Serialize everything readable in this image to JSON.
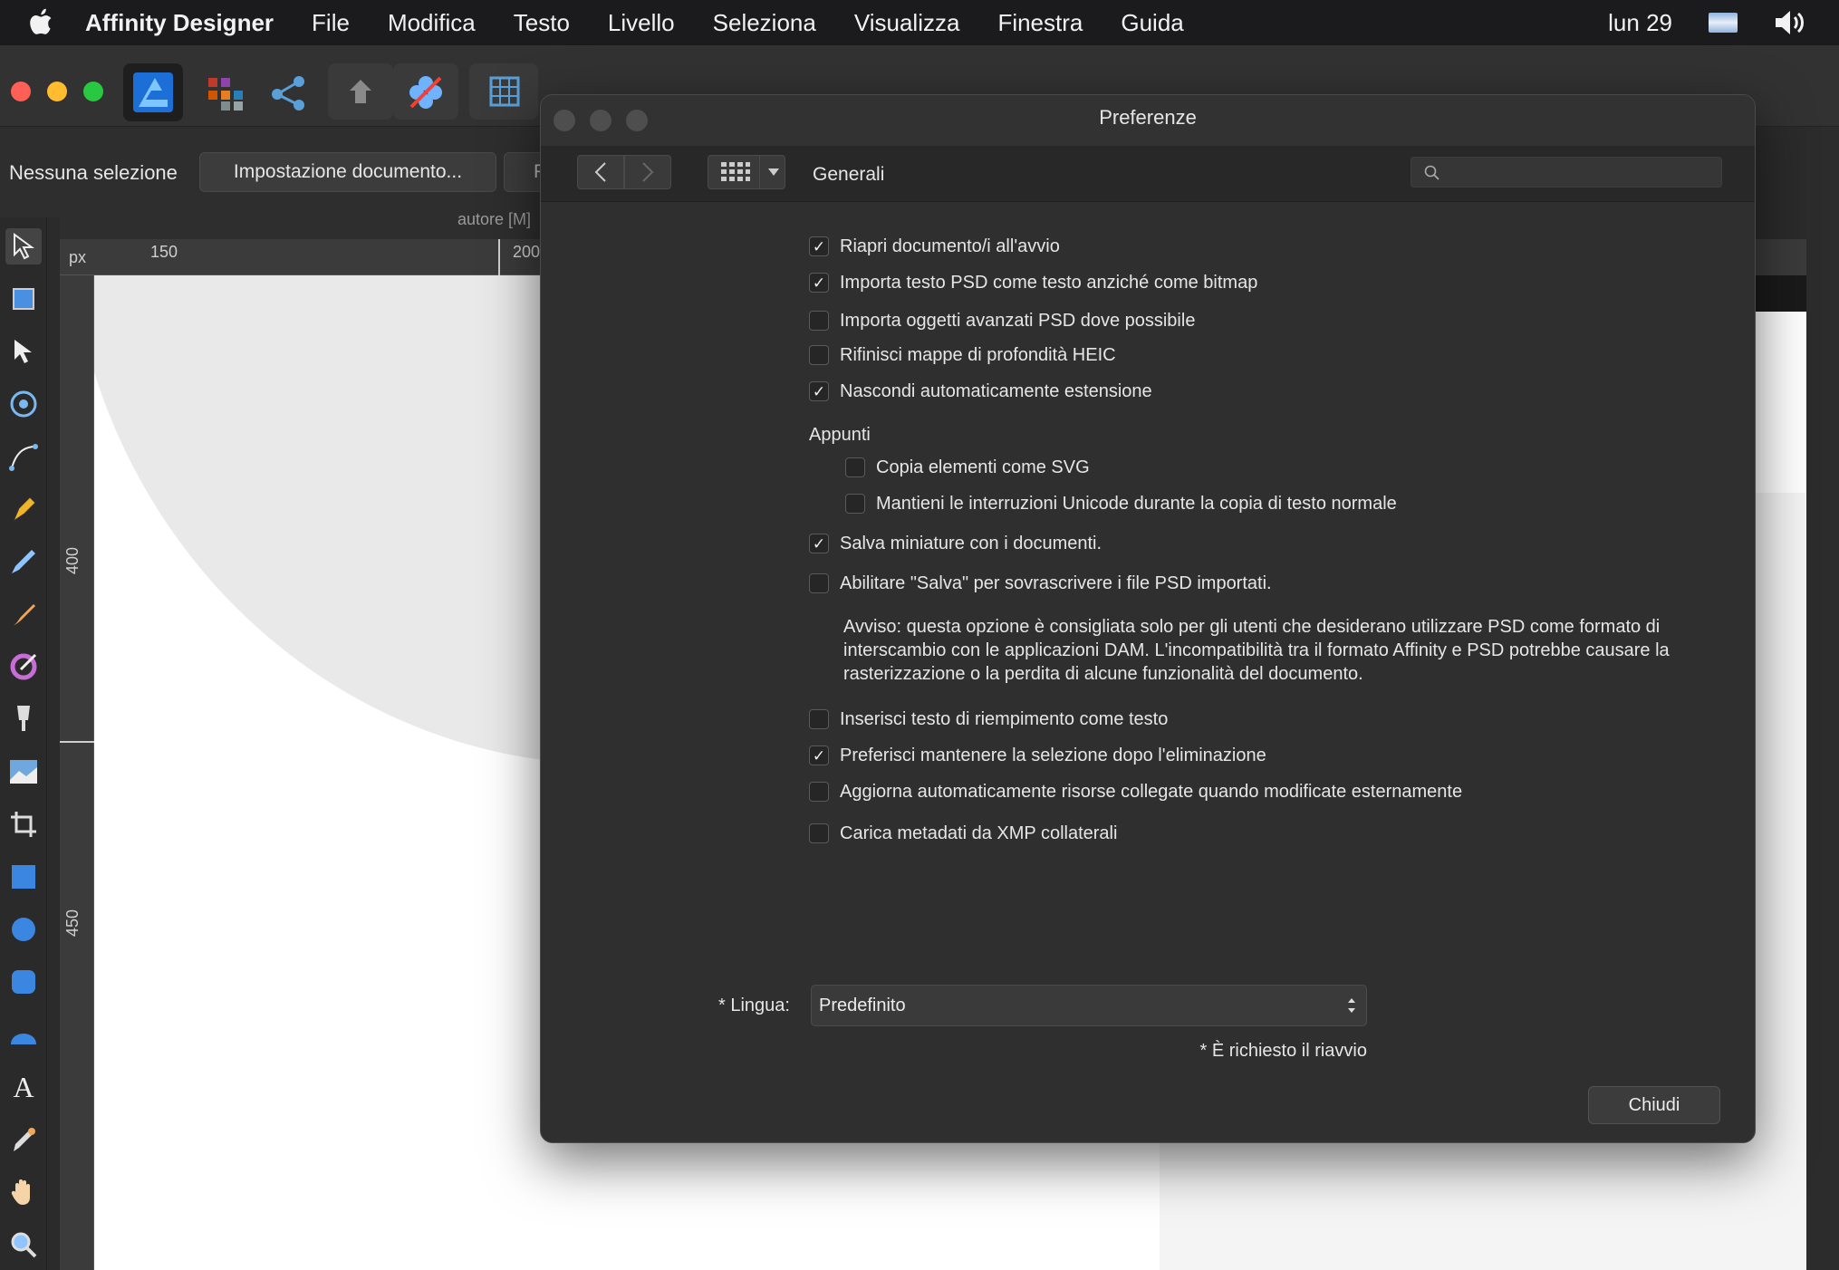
{
  "menubar": {
    "app_name": "Affinity Designer",
    "items": [
      "File",
      "Modifica",
      "Testo",
      "Livello",
      "Seleziona",
      "Visualizza",
      "Finestra",
      "Guida"
    ],
    "clock": "lun 29"
  },
  "context_bar": {
    "selection_status": "Nessuna selezione",
    "document_setup_button": "Impostazione documento...",
    "next_button_partial": "P"
  },
  "document": {
    "tab_title": "autore [M]",
    "ruler_unit": "px",
    "ruler_h_labels": [
      "150",
      "200"
    ],
    "ruler_v_labels": [
      "400",
      "450"
    ]
  },
  "preferences": {
    "title": "Preferenze",
    "section": "Generali",
    "search_placeholder": "",
    "options": [
      {
        "label": "Riapri documento/i all'avvio",
        "checked": true
      },
      {
        "label": "Importa testo PSD come testo anziché come bitmap",
        "checked": true
      },
      {
        "label": "Importa oggetti avanzati PSD dove possibile",
        "checked": false
      },
      {
        "label": "Rifinisci mappe di profondità HEIC",
        "checked": false
      },
      {
        "label": "Nascondi automaticamente estensione",
        "checked": true
      }
    ],
    "clipboard": {
      "label": "Appunti",
      "options": [
        {
          "label": "Copia elementi come SVG",
          "checked": false
        },
        {
          "label": "Mantieni le interruzioni Unicode durante la copia di testo normale",
          "checked": false
        }
      ]
    },
    "options2": [
      {
        "label": "Salva miniature con i documenti.",
        "checked": true
      },
      {
        "label": "Abilitare \"Salva\" per sovrascrivere i file PSD importati.",
        "checked": false
      }
    ],
    "warning": "Avviso: questa opzione è consigliata solo per gli utenti che desiderano utilizzare PSD come formato di interscambio con le applicazioni DAM. L'incompatibilità tra il formato Affinity e PSD potrebbe causare la rasterizzazione o la perdita di alcune funzionalità del documento.",
    "options3": [
      {
        "label": "Inserisci testo di riempimento come testo",
        "checked": false
      },
      {
        "label": "Preferisci mantenere la selezione dopo l'eliminazione",
        "checked": true
      },
      {
        "label": "Aggiorna automaticamente risorse collegate quando modificate esternamente",
        "checked": false
      },
      {
        "label": "Carica metadati da XMP collaterali",
        "checked": false
      }
    ],
    "language_label": "* Lingua:",
    "language_value": "Predefinito",
    "restart_note": "* È richiesto il riavvio",
    "close_button": "Chiudi",
    "check_glyph": "✓"
  },
  "colors": {
    "traffic_red": "#ff5f57",
    "traffic_yellow": "#febc2e",
    "traffic_green": "#28c840",
    "persona_blue": "#3aa0ff"
  }
}
